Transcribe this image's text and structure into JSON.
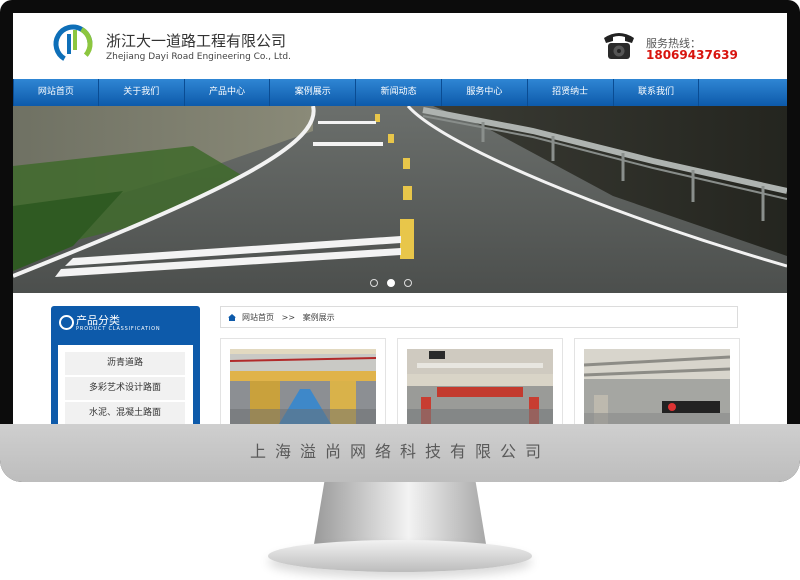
{
  "header": {
    "company_name": "浙江大一道路工程有限公司",
    "company_name_en": "Zhejiang Dayi Road Engineering Co., Ltd.",
    "hotline_label": "服务热线：",
    "hotline_number": "18069437639"
  },
  "nav": {
    "items": [
      "网站首页",
      "关于我们",
      "产品中心",
      "案例展示",
      "新闻动态",
      "服务中心",
      "招贤纳士",
      "联系我们"
    ]
  },
  "banner": {
    "slides": 3,
    "active_slide": 2
  },
  "sidebar": {
    "title": "产品分类",
    "subtitle": "PRODUCT CLASSIFICATION",
    "items": [
      "沥青道路",
      "多彩艺术设计路面",
      "水泥、混凝土路面"
    ]
  },
  "breadcrumb": {
    "home": "网站首页",
    "separator": ">>",
    "current": "案例展示"
  },
  "cases": {
    "count": 3
  },
  "monitor": {
    "brand_text": "上海溢尚网络科技有限公司"
  },
  "colors": {
    "nav_blue": "#0d5aaa",
    "hotline_red": "#d8140e",
    "sidebar_blue": "#0d5aaa"
  }
}
